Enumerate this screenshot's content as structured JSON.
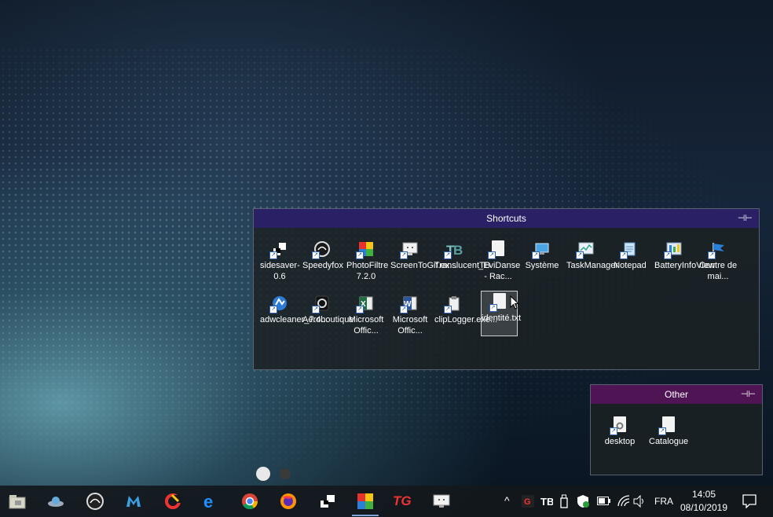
{
  "shortcuts_fence": {
    "title": "Shortcuts",
    "pin": "⊣⊢",
    "icons": [
      {
        "label": "sidesaver-0.6",
        "icon": "sidesaver-icon"
      },
      {
        "label": "Speedyfox",
        "icon": "speedyfox-icon"
      },
      {
        "label": "PhotoFiltre 7.2.0",
        "icon": "photofiltre-icon"
      },
      {
        "label": "ScreenToGif.ex...",
        "icon": "screentogif-icon"
      },
      {
        "label": "TranslucentTB",
        "icon": "translucenttb-icon"
      },
      {
        "label": "_EviDanse - Rac...",
        "icon": "file-shortcut-icon"
      },
      {
        "label": "Système",
        "icon": "system-icon"
      },
      {
        "label": "TaskManager",
        "icon": "taskmanager-icon"
      },
      {
        "label": "Notepad",
        "icon": "notepad-icon"
      },
      {
        "label": "BatteryInfoView",
        "icon": "battery-info-icon"
      },
      {
        "label": "Centre de mai...",
        "icon": "maintenance-center-icon"
      },
      {
        "label": "adwcleaner_7.4...",
        "icon": "adwcleaner-icon"
      },
      {
        "label": "Aéroboutique",
        "icon": "aeroboutique-icon"
      },
      {
        "label": "Microsoft Offic...",
        "icon": "excel-icon"
      },
      {
        "label": "Microsoft Offic...",
        "icon": "word-icon"
      },
      {
        "label": "clipLogger.exe...",
        "icon": "cliplogger-icon"
      },
      {
        "label": "identité.txt",
        "icon": "text-file-icon",
        "selected": true
      }
    ]
  },
  "other_fence": {
    "title": "Other",
    "pin": "⊣⊢",
    "icons": [
      {
        "label": "desktop",
        "icon": "settings-file-icon"
      },
      {
        "label": "Catalogue",
        "icon": "document-icon"
      }
    ]
  },
  "taskbar": {
    "apps": [
      "file-explorer-icon",
      "ufo-icon",
      "speedyfox-icon",
      "malwarebytes-icon",
      "ccleaner-icon",
      "edge-icon",
      "chrome-icon",
      "firefox-icon",
      "sidesaver-icon",
      "photofiltre-icon",
      "tg-icon",
      "screen-icon"
    ],
    "tg_text": "TG",
    "tray": {
      "chevron": "^",
      "language": "FRA",
      "time": "14:05",
      "date": "08/10/2019"
    }
  },
  "colors": {
    "shortcuts_title_bg": "#2a2066",
    "other_title_bg": "#4e1453",
    "taskbar_bg": "#14181c"
  }
}
